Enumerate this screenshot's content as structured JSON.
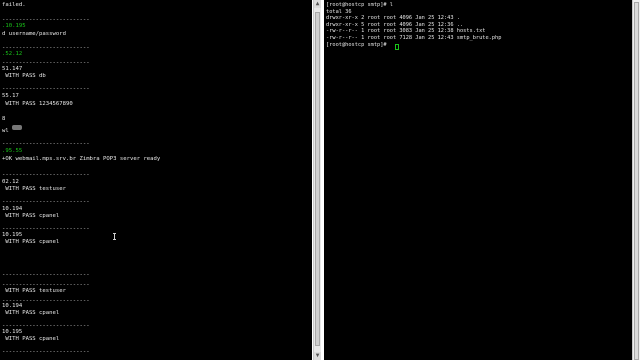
{
  "left_terminal": {
    "lines": [
      "failed.",
      "--------------------------",
      ".10.195",
      "d username/password",
      "--------------------------",
      ".52.12",
      "--------------------------",
      "51.147",
      " WITH PASS db",
      "--------------------------",
      "55.17",
      " WITH PASS 1234567890",
      "8",
      "wl",
      "--------------------------",
      ".95.55",
      "+OK webmail.mps.srv.br Zimbra POP3 server ready",
      "--------------------------",
      "02.12",
      " WITH PASS testuser",
      "--------------------------",
      "10.194",
      " WITH PASS cpanel",
      "--------------------------",
      "10.195",
      " WITH PASS cpanel",
      "--------------------------",
      "--------------------------",
      " WITH PASS testuser",
      "--------------------------",
      "10.194",
      " WITH PASS cpanel",
      "--------------------------",
      "10.195",
      " WITH PASS cpanel",
      "--------------------------"
    ]
  },
  "right_terminal": {
    "lines": [
      "[root@hostcp smtp]# l",
      "total 36",
      "drwxr-xr-x 2 root root 4096 Jan 25 12:43 .",
      "drwxr-xr-x 5 root root 4096 Jan 25 12:36 ..",
      "-rw-r--r-- 1 root root 3083 Jan 25 12:38 hosts.txt",
      "-rw-r--r-- 1 root root 7128 Jan 25 12:43 smtp_brute.php",
      "[root@hostcp smtp]# "
    ]
  },
  "colors": {
    "terminal_bg": "#000000",
    "text": "#e8e8e8",
    "green": "#19c419"
  }
}
